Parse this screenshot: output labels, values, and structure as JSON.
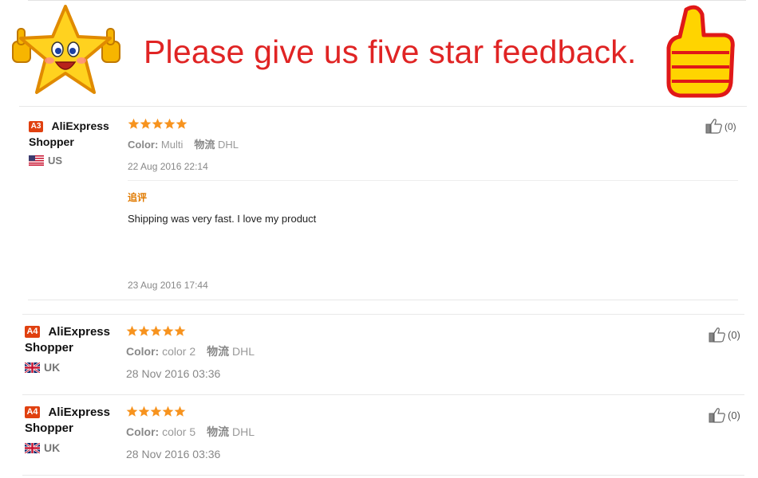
{
  "banner": {
    "title": "Please give us five star feedback."
  },
  "reviews": [
    {
      "level": "A3",
      "buyer_line1": "AliExpress",
      "buyer_line2": "Shopper",
      "country": "US",
      "rating": 5,
      "color_label": "Color:",
      "color_value": "Multi",
      "shipping_label": "物流",
      "shipping_value": "DHL",
      "date": "22 Aug 2016 22:14",
      "followup_label": "追评",
      "followup_text": "Shipping was very fast. I love my product",
      "followup_date": "23 Aug 2016 17:44",
      "helpful_count": "(0)"
    },
    {
      "level": "A4",
      "buyer_line1": "AliExpress",
      "buyer_line2": "Shopper",
      "country": "UK",
      "rating": 5,
      "color_label": "Color:",
      "color_value": "color 2",
      "shipping_label": "物流",
      "shipping_value": "DHL",
      "date": "28 Nov 2016 03:36",
      "helpful_count": "(0)"
    },
    {
      "level": "A4",
      "buyer_line1": "AliExpress",
      "buyer_line2": "Shopper",
      "country": "UK",
      "rating": 5,
      "color_label": "Color:",
      "color_value": "color 5",
      "shipping_label": "物流",
      "shipping_value": "DHL",
      "date": "28 Nov 2016 03:36",
      "helpful_count": "(0)"
    }
  ],
  "colors": {
    "title_red": "#e02424",
    "star_orange": "#f7931e",
    "badge_red": "#e0400f",
    "followup_orange": "#e07a00"
  },
  "icons": {
    "banner_left": "smiling-star-mascot-icon",
    "banner_right": "thumbs-up-mascot-icon",
    "rating": "star-icon",
    "helpful": "thumbs-up-icon",
    "flag_us": "us-flag-icon",
    "flag_uk": "uk-flag-icon"
  }
}
